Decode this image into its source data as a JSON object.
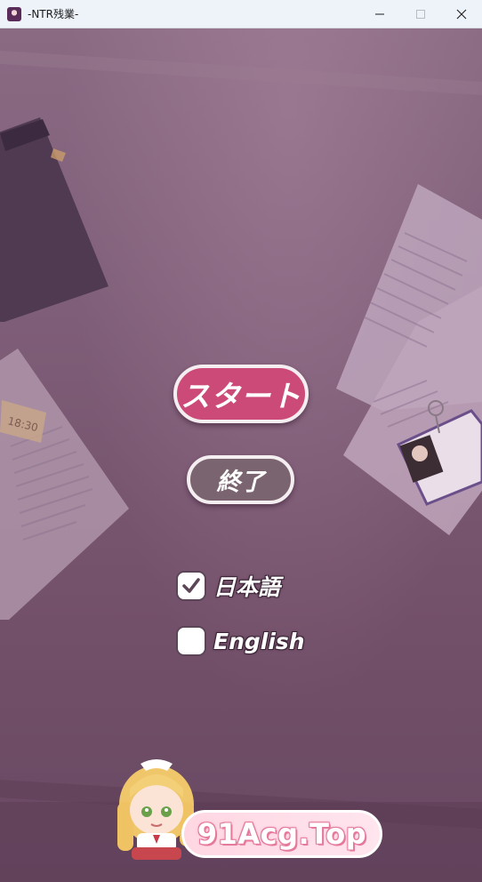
{
  "window": {
    "title": "-NTR残業-"
  },
  "menu": {
    "start_label": "スタート",
    "quit_label": "終了"
  },
  "languages": [
    {
      "label": "日本語",
      "checked": true
    },
    {
      "label": "English",
      "checked": false
    }
  ],
  "desk": {
    "badge_tag": "18:30"
  },
  "watermark": {
    "text": "91Acg.Top"
  },
  "colors": {
    "start_button": "#cc4a77",
    "quit_button": "#7a646f",
    "background": "#7a5873",
    "watermark_pink": "#ffd7e3"
  },
  "icons": {
    "app": "app-icon",
    "minimize": "minimize-icon",
    "maximize": "maximize-icon",
    "close": "close-icon",
    "check": "check-icon"
  }
}
